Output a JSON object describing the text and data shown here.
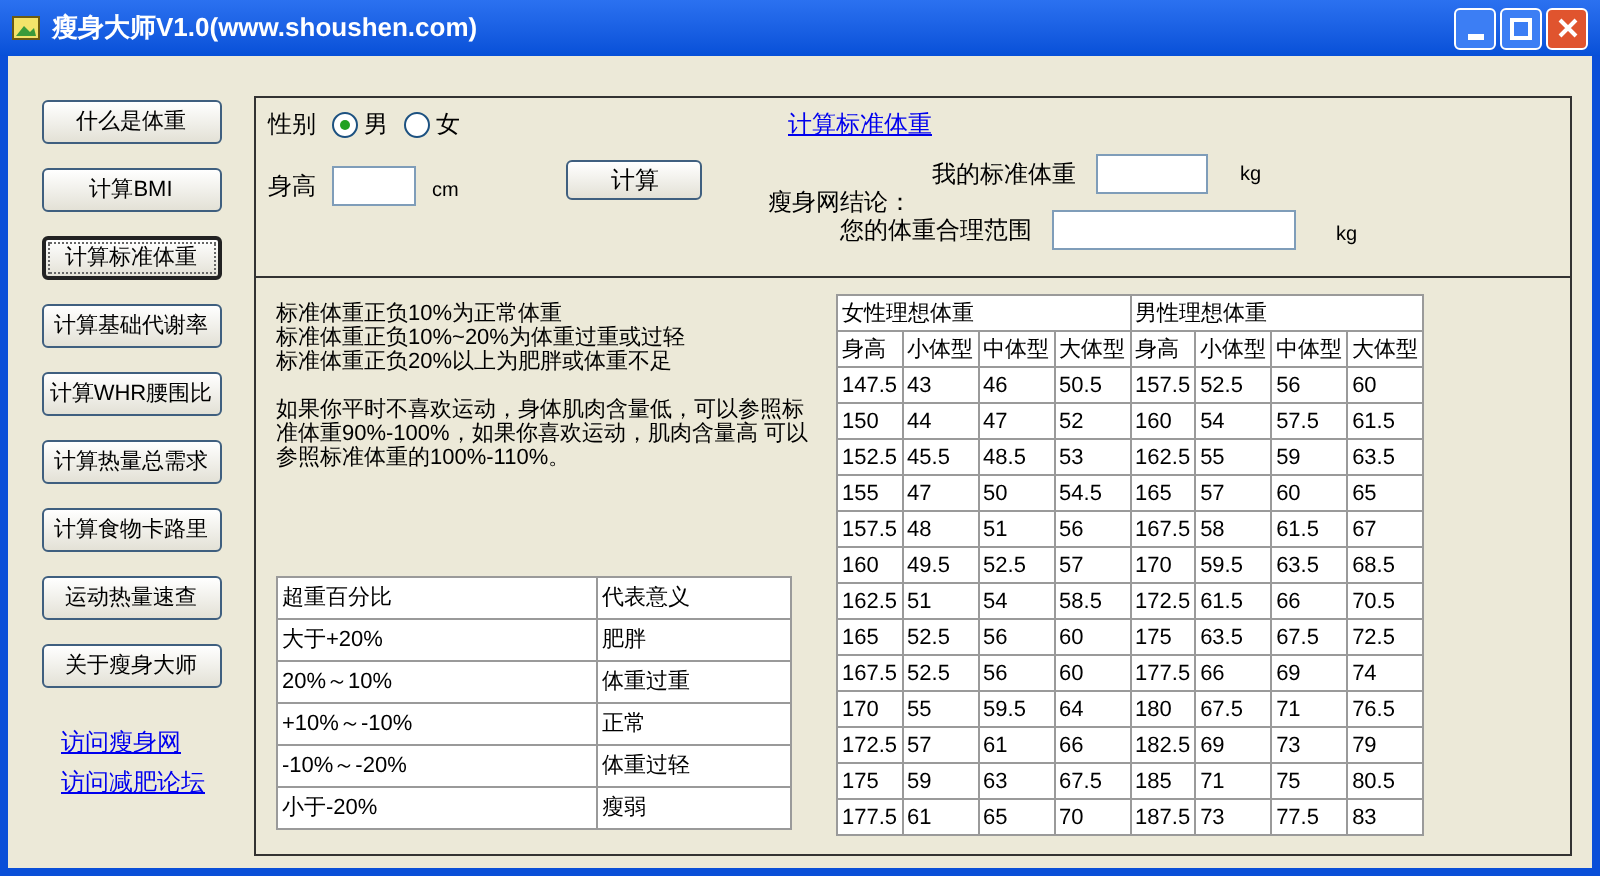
{
  "window": {
    "title": "瘦身大师V1.0(www.shoushen.com)"
  },
  "sidebar": {
    "buttons": [
      {
        "label": "什么是体重",
        "selected": false
      },
      {
        "label": "计算BMI",
        "selected": false
      },
      {
        "label": "计算标准体重",
        "selected": true
      },
      {
        "label": "计算基础代谢率",
        "selected": false
      },
      {
        "label": "计算WHR腰围比",
        "selected": false
      },
      {
        "label": "计算热量总需求",
        "selected": false
      },
      {
        "label": "计算食物卡路里",
        "selected": false
      },
      {
        "label": "运动热量速查",
        "selected": false
      },
      {
        "label": "关于瘦身大师",
        "selected": false
      }
    ],
    "links": [
      "访问瘦身网",
      "访问减肥论坛"
    ]
  },
  "form": {
    "gender_label": "性别",
    "gender_options": [
      {
        "label": "男",
        "selected": true
      },
      {
        "label": "女",
        "selected": false
      }
    ],
    "height_label": "身高",
    "height_unit": "cm",
    "calc_button": "计算",
    "link": "计算标准体重",
    "conclusion_label": "瘦身网结论：",
    "fields": [
      {
        "label": "我的标准体重",
        "unit": "kg"
      },
      {
        "label": "您的体重合理范围",
        "unit": "kg"
      }
    ]
  },
  "notes": [
    "标准体重正负10%为正常体重",
    "标准体重正负10%~20%为体重过重或过轻",
    "标准体重正负20%以上为肥胖或体重不足",
    "如果你平时不喜欢运动，身体肌肉含量低，可以参照标准体重90%-100%，如果你喜欢运动，肌肉含量高 可以参照标准体重的100%-110%。"
  ],
  "overweight_table": {
    "columns": [
      "超重百分比",
      "代表意义"
    ],
    "rows": [
      [
        "大于+20%",
        "肥胖"
      ],
      [
        "20%～10%",
        "体重过重"
      ],
      [
        "+10%～-10%",
        "正常"
      ],
      [
        "-10%～-20%",
        "体重过轻"
      ],
      [
        "小于-20%",
        "瘦弱"
      ]
    ]
  },
  "ideal_table": {
    "groups": [
      "女性理想体重",
      "男性理想体重"
    ],
    "columns": [
      "身高",
      "小体型",
      "中体型",
      "大体型",
      "身高",
      "小体型",
      "中体型",
      "大体型"
    ],
    "rows": [
      [
        "147.5",
        "43",
        "46",
        "50.5",
        "157.5",
        "52.5",
        "56",
        "60"
      ],
      [
        "150",
        "44",
        "47",
        "52",
        "160",
        "54",
        "57.5",
        "61.5"
      ],
      [
        "152.5",
        "45.5",
        "48.5",
        "53",
        "162.5",
        "55",
        "59",
        "63.5"
      ],
      [
        "155",
        "47",
        "50",
        "54.5",
        "165",
        "57",
        "60",
        "65"
      ],
      [
        "157.5",
        "48",
        "51",
        "56",
        "167.5",
        "58",
        "61.5",
        "67"
      ],
      [
        "160",
        "49.5",
        "52.5",
        "57",
        "170",
        "59.5",
        "63.5",
        "68.5"
      ],
      [
        "162.5",
        "51",
        "54",
        "58.5",
        "172.5",
        "61.5",
        "66",
        "70.5"
      ],
      [
        "165",
        "52.5",
        "56",
        "60",
        "175",
        "63.5",
        "67.5",
        "72.5"
      ],
      [
        "167.5",
        "52.5",
        "56",
        "60",
        "177.5",
        "66",
        "69",
        "74"
      ],
      [
        "170",
        "55",
        "59.5",
        "64",
        "180",
        "67.5",
        "71",
        "76.5"
      ],
      [
        "172.5",
        "57",
        "61",
        "66",
        "182.5",
        "69",
        "73",
        "79"
      ],
      [
        "175",
        "59",
        "63",
        "67.5",
        "185",
        "71",
        "75",
        "80.5"
      ],
      [
        "177.5",
        "61",
        "65",
        "70",
        "187.5",
        "73",
        "77.5",
        "83"
      ]
    ]
  }
}
